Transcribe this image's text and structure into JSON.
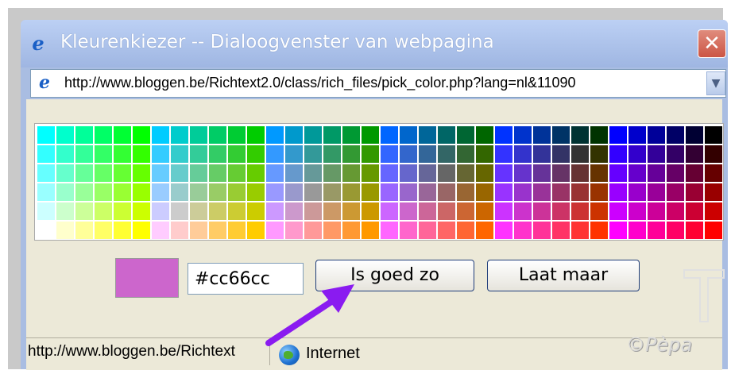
{
  "window": {
    "title": "Kleurenkiezer -- Dialoogvenster van webpagina",
    "close_glyph": "✕"
  },
  "address_bar": {
    "url": "http://www.bloggen.be/Richtext2.0/class/rich_files/pick_color.php?lang=nl&11090"
  },
  "color_grid": {
    "rows": [
      [
        "#00ffff",
        "#00ffcc",
        "#00ff99",
        "#00ff66",
        "#00ff33",
        "#00ff00",
        "#00ccff",
        "#00cccc",
        "#00cc99",
        "#00cc66",
        "#00cc33",
        "#00cc00",
        "#0099ff",
        "#0099cc",
        "#009999",
        "#009966",
        "#009933",
        "#009900",
        "#0066ff",
        "#0066cc",
        "#006699",
        "#006666",
        "#006633",
        "#006600",
        "#0033ff",
        "#0033cc",
        "#003399",
        "#003366",
        "#003333",
        "#003300",
        "#0000ff",
        "#0000cc",
        "#000099",
        "#000066",
        "#000033",
        "#000000"
      ],
      [
        "#33ffff",
        "#33ffcc",
        "#33ff99",
        "#33ff66",
        "#33ff33",
        "#33ff00",
        "#33ccff",
        "#33cccc",
        "#33cc99",
        "#33cc66",
        "#33cc33",
        "#33cc00",
        "#3399ff",
        "#3399cc",
        "#339999",
        "#339966",
        "#339933",
        "#339900",
        "#3366ff",
        "#3366cc",
        "#336699",
        "#336666",
        "#336633",
        "#336600",
        "#3333ff",
        "#3333cc",
        "#333399",
        "#333366",
        "#333333",
        "#333300",
        "#3300ff",
        "#3300cc",
        "#330099",
        "#330066",
        "#330033",
        "#330000"
      ],
      [
        "#66ffff",
        "#66ffcc",
        "#66ff99",
        "#66ff66",
        "#66ff33",
        "#66ff00",
        "#66ccff",
        "#66cccc",
        "#66cc99",
        "#66cc66",
        "#66cc33",
        "#66cc00",
        "#6699ff",
        "#6699cc",
        "#669999",
        "#669966",
        "#669933",
        "#669900",
        "#6666ff",
        "#6666cc",
        "#666699",
        "#666666",
        "#666633",
        "#666600",
        "#6633ff",
        "#6633cc",
        "#663399",
        "#663366",
        "#663333",
        "#663300",
        "#6600ff",
        "#6600cc",
        "#660099",
        "#660066",
        "#660033",
        "#660000"
      ],
      [
        "#99ffff",
        "#99ffcc",
        "#99ff99",
        "#99ff66",
        "#99ff33",
        "#99ff00",
        "#99ccff",
        "#99cccc",
        "#99cc99",
        "#99cc66",
        "#99cc33",
        "#99cc00",
        "#9999ff",
        "#9999cc",
        "#999999",
        "#999966",
        "#999933",
        "#999900",
        "#9966ff",
        "#9966cc",
        "#996699",
        "#996666",
        "#996633",
        "#996600",
        "#9933ff",
        "#9933cc",
        "#993399",
        "#993366",
        "#993333",
        "#993300",
        "#9900ff",
        "#9900cc",
        "#990099",
        "#990066",
        "#990033",
        "#990000"
      ],
      [
        "#ccffff",
        "#ccffcc",
        "#ccff99",
        "#ccff66",
        "#ccff33",
        "#ccff00",
        "#ccccff",
        "#cccccc",
        "#cccc99",
        "#cccc66",
        "#cccc33",
        "#cccc00",
        "#cc99ff",
        "#cc99cc",
        "#cc9999",
        "#cc9966",
        "#cc9933",
        "#cc9900",
        "#cc66ff",
        "#cc66cc",
        "#cc6699",
        "#cc6666",
        "#cc6633",
        "#cc6600",
        "#cc33ff",
        "#cc33cc",
        "#cc3399",
        "#cc3366",
        "#cc3333",
        "#cc3300",
        "#cc00ff",
        "#cc00cc",
        "#cc0099",
        "#cc0066",
        "#cc0033",
        "#cc0000"
      ],
      [
        "#ffffff",
        "#ffffcc",
        "#ffff99",
        "#ffff66",
        "#ffff33",
        "#ffff00",
        "#ffccff",
        "#ffcccc",
        "#ffcc99",
        "#ffcc66",
        "#ffcc33",
        "#ffcc00",
        "#ff99ff",
        "#ff99cc",
        "#ff9999",
        "#ff9966",
        "#ff9933",
        "#ff9900",
        "#ff66ff",
        "#ff66cc",
        "#ff6699",
        "#ff6666",
        "#ff6633",
        "#ff6600",
        "#ff33ff",
        "#ff33cc",
        "#ff3399",
        "#ff3366",
        "#ff3333",
        "#ff3300",
        "#ff00ff",
        "#ff00cc",
        "#ff0099",
        "#ff0066",
        "#ff0033",
        "#ff0000"
      ]
    ]
  },
  "selection": {
    "preview_color": "#cc66cc",
    "hex_value": "#cc66cc"
  },
  "buttons": {
    "ok_label": "Is goed zo",
    "cancel_label": "Laat maar"
  },
  "statusbar": {
    "url_text": "http://www.bloggen.be/Richtext",
    "zone_text": "Internet"
  },
  "watermark": {
    "text": "©Pèpa"
  },
  "annotation": {
    "arrow_color": "#8a1bf0"
  },
  "icons": {
    "title": "ie-icon",
    "address": "ie-page-icon",
    "dropdown": "chevron-down-icon",
    "status_zone": "globe-icon"
  }
}
